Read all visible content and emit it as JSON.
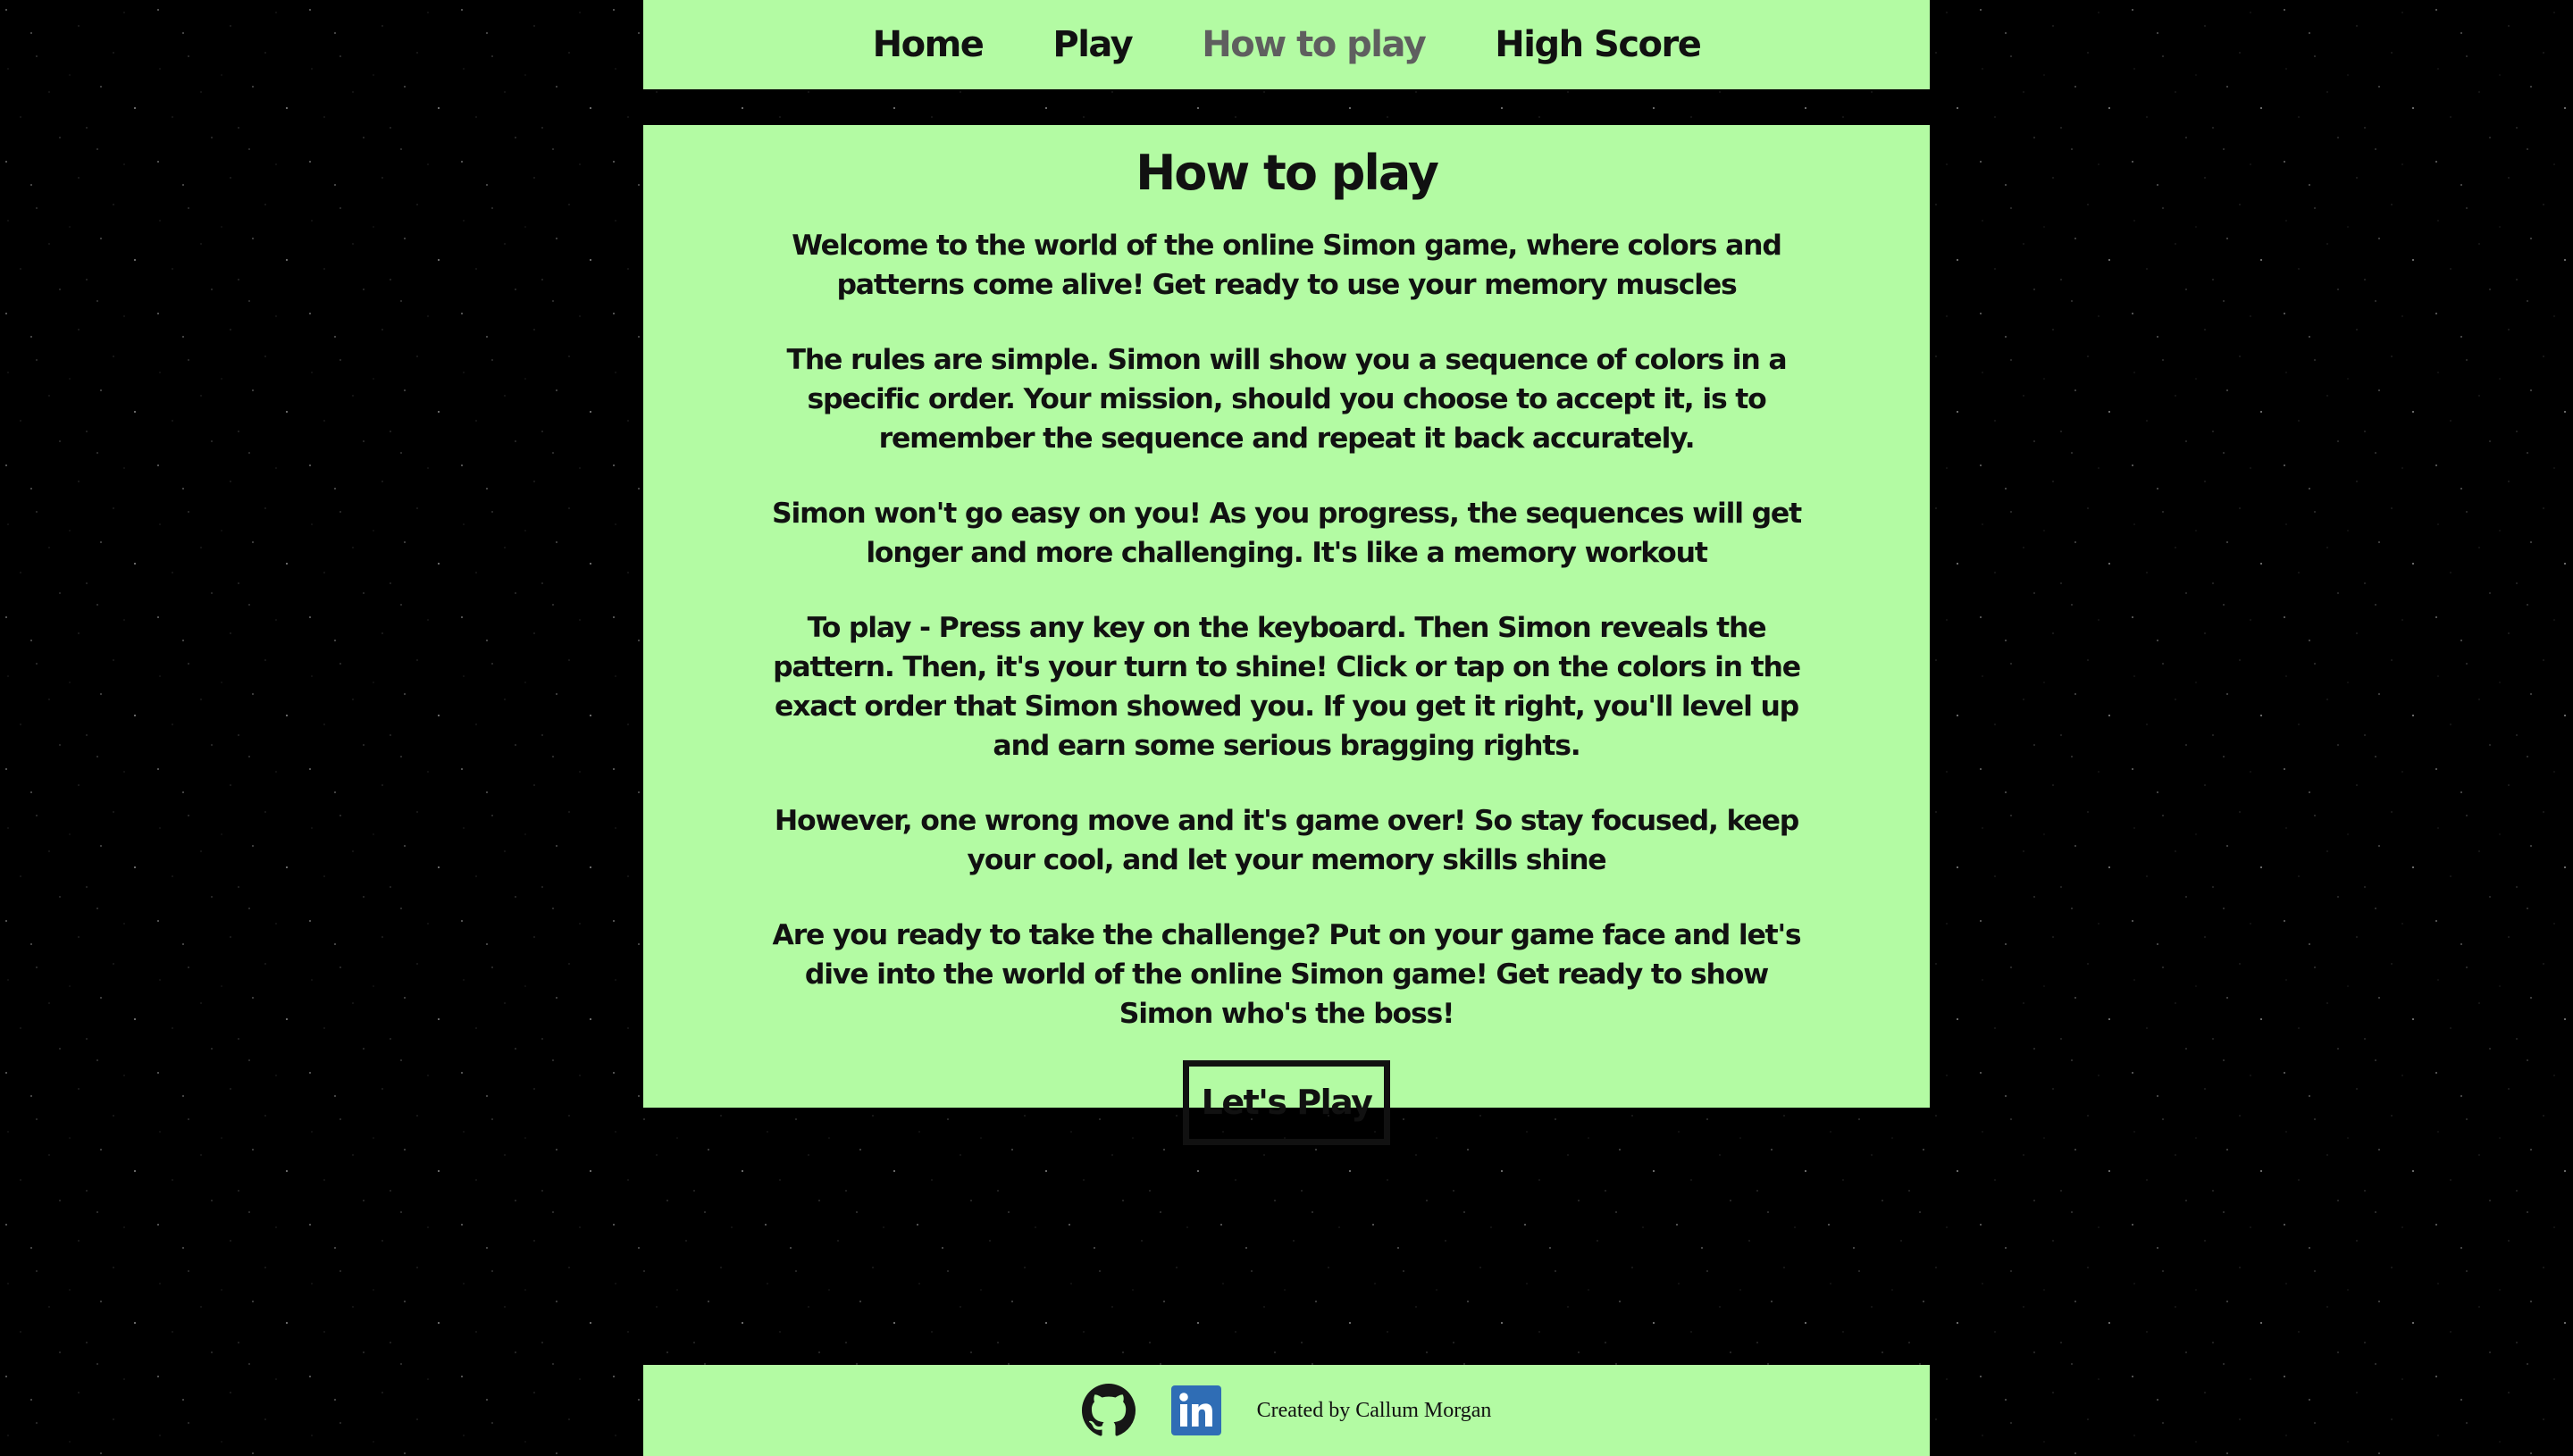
{
  "nav": {
    "items": [
      {
        "label": "Home"
      },
      {
        "label": "Play"
      },
      {
        "label": "How to play",
        "active": true
      },
      {
        "label": "High Score"
      }
    ]
  },
  "main": {
    "title": "How to play",
    "paragraphs": [
      "Welcome to the world of the online Simon game, where colors and patterns come alive! Get ready to use your memory muscles",
      "The rules are simple. Simon will show you a sequence of colors in a specific order. Your mission, should you choose to accept it, is to remember the sequence and repeat it back accurately.",
      "Simon won't go easy on you! As you progress, the sequences will get longer and more challenging. It's like a memory workout",
      "To play - Press any key on the keyboard. Then Simon reveals the pattern. Then, it's your turn to shine! Click or tap on the colors in the exact order that Simon showed you. If you get it right, you'll level up and earn some serious bragging rights.",
      "However, one wrong move and it's game over! So stay focused, keep your cool, and let your memory skills shine",
      "Are you ready to take the challenge? Put on your game face and let's dive into the world of the online Simon game! Get ready to show Simon who's the boss!"
    ],
    "play_button": "Let's Play"
  },
  "footer": {
    "icons": [
      "github-icon",
      "linkedin-icon"
    ],
    "credit": "Created by Callum Morgan"
  },
  "colors": {
    "panel_background": "#b3fba3",
    "page_background": "#000000",
    "active_nav": "#5f5f5f",
    "text": "#111111",
    "linkedin": "#2f6db5"
  }
}
